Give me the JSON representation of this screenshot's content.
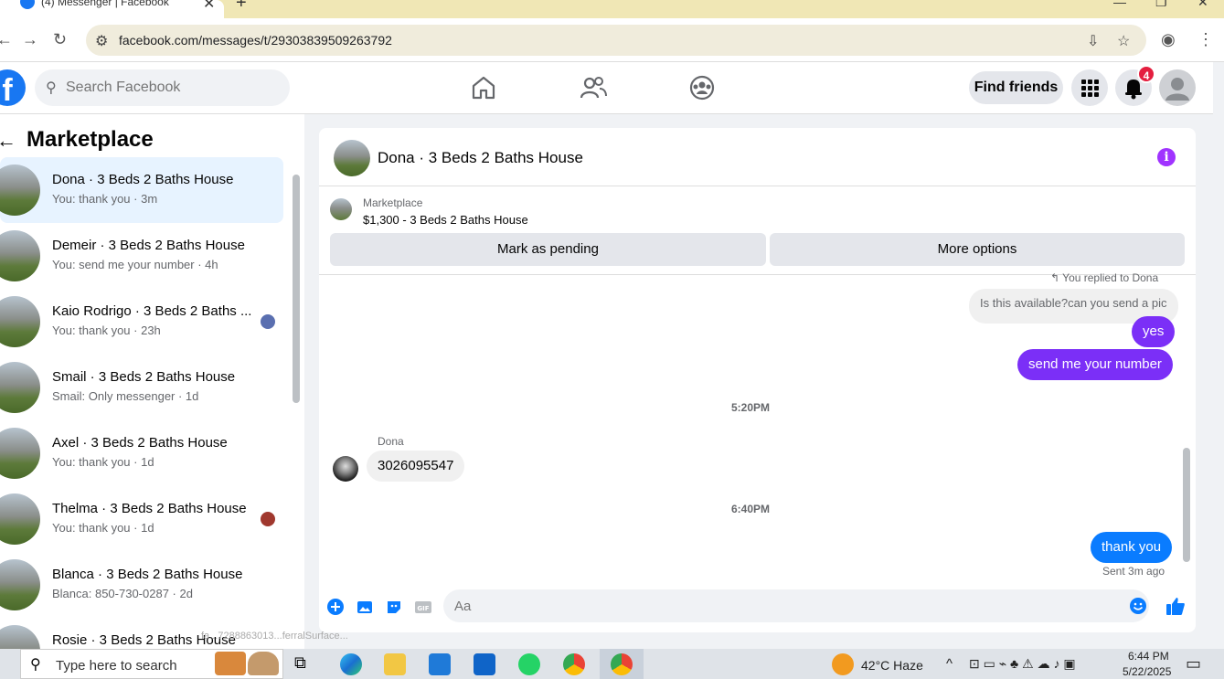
{
  "browser": {
    "tab_title": "(4) Messenger | Facebook",
    "url": "facebook.com/messages/t/29303839509263792"
  },
  "header": {
    "search_placeholder": "Search Facebook",
    "find_friends": "Find friends",
    "notifications_count": "4"
  },
  "sidebar": {
    "title": "Marketplace",
    "conversations": [
      {
        "name": "Dona · 3 Beds 2 Baths House",
        "preview": "You: thank you · 3m",
        "active": true
      },
      {
        "name": "Demeir · 3 Beds 2 Baths House",
        "preview": "You: send me your number · 4h"
      },
      {
        "name": "Kaio Rodrigo · 3 Beds 2 Baths ...",
        "preview": "You: thank you · 23h"
      },
      {
        "name": "Smail · 3 Beds 2 Baths House",
        "preview": "Smail: Only messenger · 1d"
      },
      {
        "name": "Axel · 3 Beds 2 Baths House",
        "preview": "You: thank you · 1d"
      },
      {
        "name": "Thelma · 3 Beds 2 Baths House",
        "preview": "You: thank you · 1d"
      },
      {
        "name": "Blanca · 3 Beds 2 Baths House",
        "preview": "Blanca: 850-730-0287 · 2d"
      },
      {
        "name": "Rosie · 3 Beds 2 Baths House",
        "preview": ""
      }
    ]
  },
  "chat": {
    "title": "Dona · 3 Beds 2 Baths House",
    "marketplace_label": "Marketplace",
    "listing": "$1,300 - 3 Beds 2 Baths House",
    "mark_pending": "Mark as pending",
    "more_options": "More options",
    "replied_note": "You replied to Dona",
    "quoted_message": "Is this available?can you send a pic",
    "msg_yes": "yes",
    "msg_number": "send me your number",
    "time1": "5:20PM",
    "sender_name": "Dona",
    "msg_phone": "3026095547",
    "time2": "6:40PM",
    "msg_thanks": "thank you",
    "sent_status": "Sent 3m ago",
    "composer_placeholder": "Aa"
  },
  "status_bar_url": "fa...7288863013...ferralSurface...",
  "taskbar": {
    "search_text": "Type here to search",
    "weather": "42°C  Haze",
    "time": "6:44 PM",
    "date": "5/22/2025"
  }
}
